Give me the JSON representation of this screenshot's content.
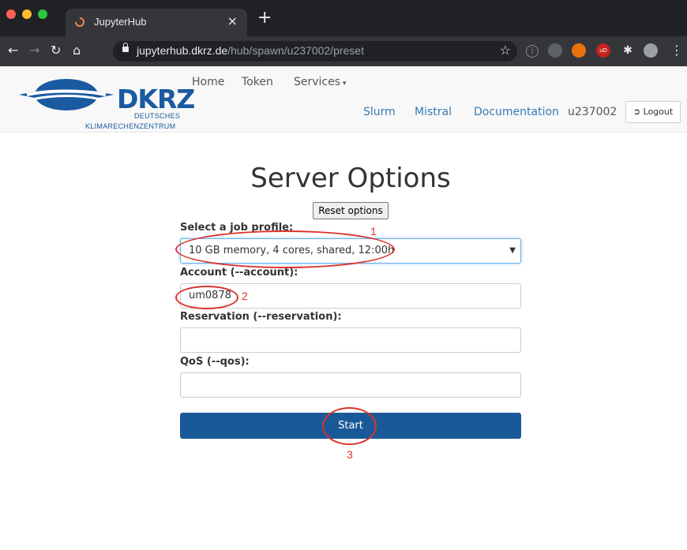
{
  "browser": {
    "tab_title": "JupyterHub",
    "tab_close": "×",
    "new_tab": "+",
    "url_host": "jupyterhub.dkrz.de",
    "url_path": "/hub/spawn/u237002/preset",
    "ext_ublock": "uD"
  },
  "header": {
    "logo_text": "DKRZ",
    "logo_sub1": "DEUTSCHES",
    "logo_sub2": "KLIMARECHENZENTRUM",
    "nav": {
      "home": "Home",
      "token": "Token",
      "services": "Services"
    },
    "right_nav": {
      "slurm": "Slurm",
      "mistral": "Mistral",
      "documentation": "Documentation",
      "user": "u237002"
    },
    "logout": "Logout"
  },
  "form": {
    "title": "Server Options",
    "reset_label": "Reset options",
    "profile_label": "Select a job profile:",
    "profile_value": "10 GB memory, 4 cores, shared, 12:00h",
    "account_label": "Account (--account):",
    "account_value": "um0878",
    "reservation_label": "Reservation (--reservation):",
    "reservation_value": "",
    "qos_label": "QoS (--qos):",
    "qos_value": "",
    "start_label": "Start"
  },
  "annotations": {
    "one": "1",
    "two": "2",
    "three": "3"
  },
  "colors": {
    "brand": "#1a5aa0",
    "start_button": "#1a5997",
    "annotation": "#d9342b"
  }
}
